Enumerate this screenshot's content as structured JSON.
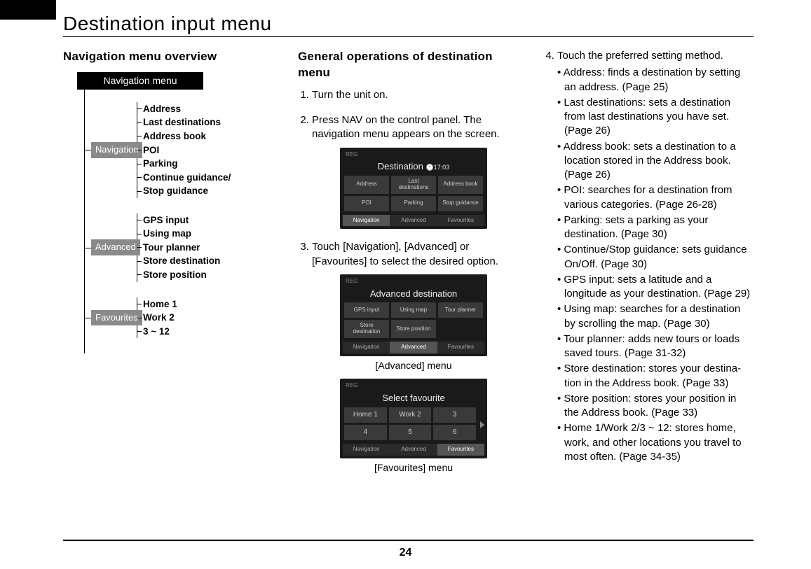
{
  "page": {
    "title": "Destination input menu",
    "number": "24"
  },
  "col1": {
    "heading": "Navigation menu overview",
    "root_label": "Navigation menu",
    "groups": [
      {
        "label": "Navigation",
        "items": [
          "Address",
          "Last destinations",
          "Address book",
          "POI",
          "Parking",
          "Continue guidance/",
          "Stop guidance"
        ]
      },
      {
        "label": "Advanced",
        "items": [
          "GPS input",
          "Using map",
          "Tour planner",
          "Store destination",
          "Store position"
        ]
      },
      {
        "label": "Favourites",
        "items": [
          "Home 1",
          "Work 2",
          "3 ~ 12"
        ]
      }
    ]
  },
  "col2": {
    "heading": "General operations of desti­nation menu",
    "steps": [
      {
        "text": "Turn the unit on."
      },
      {
        "text": "Press NAV on the control panel. The navigation menu appears on the screen."
      },
      {
        "text": "Touch [Navigation], [Advanced] or [Favourites] to select the desired option."
      }
    ],
    "shot1": {
      "reg": "REG",
      "time": "17:03",
      "title": "Destination",
      "buttons": [
        "Address",
        "Last destinations",
        "Address book",
        "POI",
        "Parking",
        "Stop guidance"
      ],
      "tabs": [
        "Navigation",
        "Advanced",
        "Favourites"
      ],
      "active_tab": 0
    },
    "shot2": {
      "reg": "REG",
      "title": "Advanced destination",
      "buttons": [
        "GPS input",
        "Using map",
        "Tour planner",
        "Store destination",
        "Store position",
        ""
      ],
      "tabs": [
        "Navigation",
        "Advanced",
        "Favourites"
      ],
      "active_tab": 1,
      "caption": "[Advanced] menu"
    },
    "shot3": {
      "reg": "REG",
      "title": "Select favourite",
      "buttons": [
        "Home 1",
        "Work 2",
        "3",
        "4",
        "5",
        "6"
      ],
      "tabs": [
        "Navigation",
        "Advanced",
        "Favourites"
      ],
      "active_tab": 2,
      "caption": "[Favourites] menu"
    }
  },
  "col3": {
    "step4_intro": "Touch the preferred setting method.",
    "bullets": [
      "Address: finds a destination by setting an address. (Page 25)",
      "Last destinations: sets a destina­tion from last destinations you have set. (Page 26)",
      "Address book: sets a destination to a location stored in the Address book. (Page 26)",
      "POI: searches for a destination from various categories. (Page 26-28)",
      "Parking: sets a parking as your destination. (Page 30)",
      "Continue/Stop guidance: sets guidance On/Off. (Page 30)",
      "GPS input: sets a latitude and a longitude as your destination. (Page 29)",
      "Using map: searches for a destina­tion by scrolling the map. (Page 30)",
      "Tour planner: adds new tours or loads saved tours. (Page 31-32)",
      "Store destination: stores your destina­tion in the Address book. (Page 33)",
      "Store position: stores your position in the Address book. (Page 33)",
      "Home 1/Work 2/3 ~ 12: stores home, work, and other locations you travel to most often. (Page 34-35)"
    ]
  }
}
